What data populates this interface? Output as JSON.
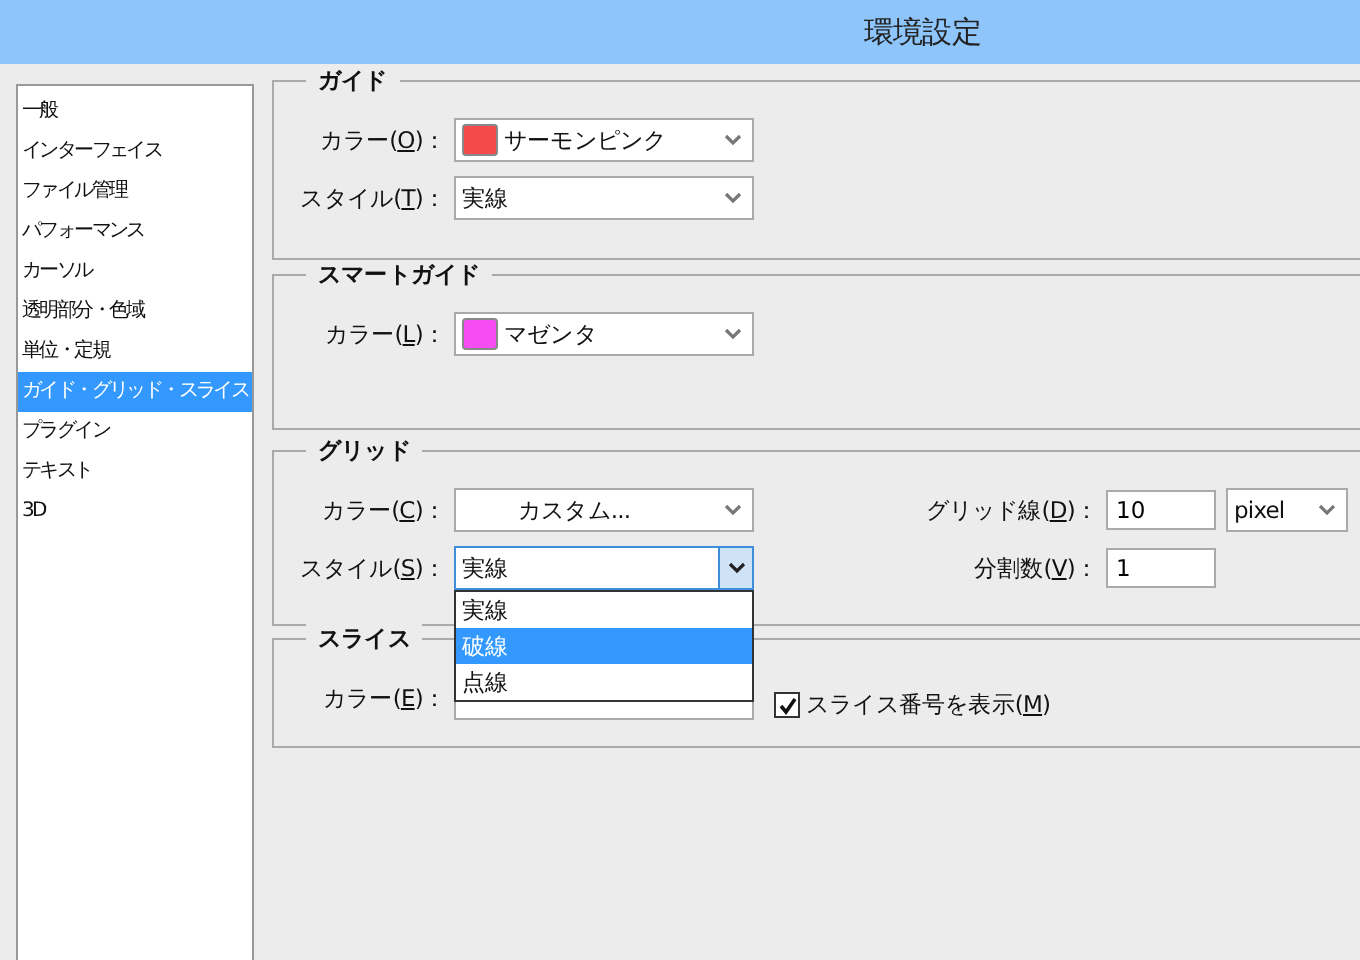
{
  "window": {
    "title": "環境設定"
  },
  "sidebar": {
    "items": [
      {
        "label": "一般",
        "selected": false
      },
      {
        "label": "インターフェイス",
        "selected": false
      },
      {
        "label": "ファイル管理",
        "selected": false
      },
      {
        "label": "パフォーマンス",
        "selected": false
      },
      {
        "label": "カーソル",
        "selected": false
      },
      {
        "label": "透明部分・色域",
        "selected": false
      },
      {
        "label": "単位・定規",
        "selected": false
      },
      {
        "label": "ガイド・グリッド・スライス",
        "selected": true
      },
      {
        "label": "プラグイン",
        "selected": false
      },
      {
        "label": "テキスト",
        "selected": false
      },
      {
        "label": "3D",
        "selected": false
      }
    ]
  },
  "sections": [
    {
      "title": "ガイド",
      "rows": [
        {
          "label": {
            "before": "カラー(",
            "key": "O",
            "after": ")："
          },
          "value": "サーモンピンク",
          "color": "#f44a4a"
        },
        {
          "label": {
            "before": "スタイル(",
            "key": "T",
            "after": ")："
          },
          "value": "実線"
        }
      ]
    },
    {
      "title": "スマートガイド",
      "rows": [
        {
          "label": {
            "before": "カラー(",
            "key": "L",
            "after": ")："
          },
          "value": "マゼンタ",
          "color": "#f64cf4"
        }
      ]
    },
    {
      "title": "グリッド",
      "rows": [
        {
          "label": {
            "before": "カラー(",
            "key": "C",
            "after": ")："
          },
          "value": "カスタム..."
        },
        {
          "label": {
            "before": "スタイル(",
            "key": "S",
            "after": ")："
          },
          "value": "実線",
          "open": true
        }
      ],
      "extra": {
        "gridline": {
          "label": {
            "before": "グリッド線(",
            "key": "D",
            "after": ")："
          },
          "value": "10",
          "unit": "pixel"
        },
        "subdivisions": {
          "label": {
            "before": "分割数(",
            "key": "V",
            "after": ")："
          },
          "value": "1"
        }
      }
    },
    {
      "title": "スライス",
      "rows": [
        {
          "label": {
            "before": "カラー(",
            "key": "E",
            "after": ")："
          }
        }
      ],
      "checkbox": {
        "label": {
          "before": "スライス番号を表示(",
          "key": "M",
          "after": ")"
        },
        "checked": true
      }
    }
  ],
  "dropdown": {
    "options": [
      {
        "label": "実線",
        "selected": false
      },
      {
        "label": "破線",
        "selected": true
      },
      {
        "label": "点線",
        "selected": false
      }
    ]
  }
}
